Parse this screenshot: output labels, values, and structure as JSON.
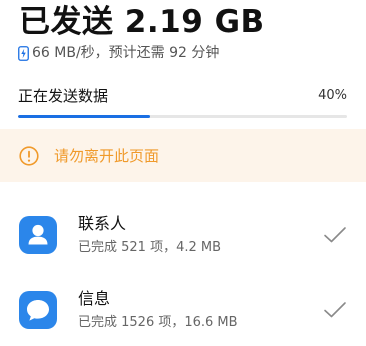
{
  "header": {
    "title": "已发送 2.19 GB",
    "speed_text": "66 MB/秒，预计还需 92 分钟",
    "speed_icon": "lightning-bolt-icon"
  },
  "status": {
    "label": "正在发送数据",
    "percent_text": "40%",
    "progress_fraction": 0.4
  },
  "warning": {
    "icon": "exclamation-circle-icon",
    "text": "请勿离开此页面"
  },
  "items": [
    {
      "icon": "contacts-icon",
      "title": "联系人",
      "subtitle": "已完成 521 项，4.2 MB",
      "status_icon": "checkmark-icon"
    },
    {
      "icon": "messages-icon",
      "title": "信息",
      "subtitle": "已完成 1526 项，16.6 MB",
      "status_icon": "checkmark-icon"
    }
  ],
  "colors": {
    "accent": "#1a6fe3",
    "icon_blue": "#2b86ea",
    "warning_text": "#f09a2b",
    "warning_background": "#fdf4ea"
  }
}
